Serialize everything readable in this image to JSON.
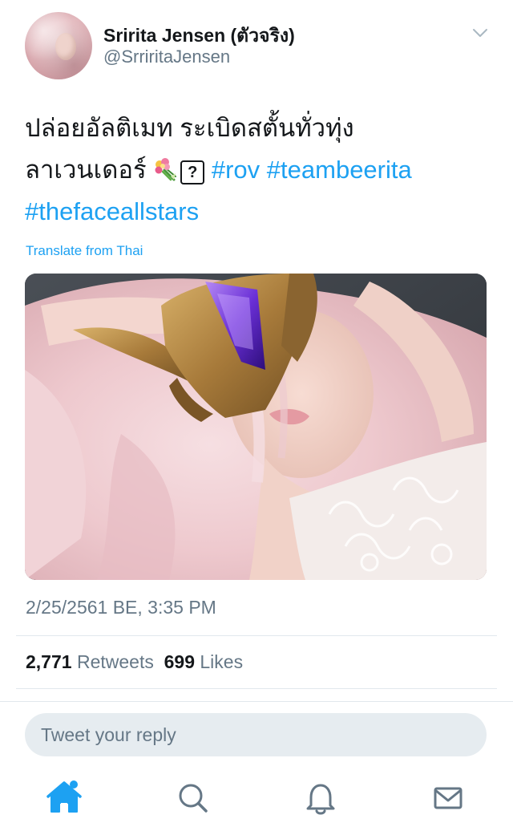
{
  "tweet": {
    "author": {
      "display_name": "Sririta Jensen (ตัวจริง)",
      "handle": "@SrriritaJensen"
    },
    "text_lines": {
      "line1": "ปล่อยอัลติเมท ระเบิดสตั้นทั่วทุ่ง",
      "line2_text": "ลาเวนเดอร์",
      "missing_glyph": "?",
      "hashtag_rov": "#rov",
      "hashtag_teambeerita": "#teambeerita",
      "hashtag_thefaceallstars": "#thefaceallstars"
    },
    "translate_label": "Translate from Thai",
    "timestamp": "2/25/2561 BE, 3:35 PM",
    "stats": {
      "retweets_count": "2,771",
      "retweets_label": "Retweets",
      "likes_count": "699",
      "likes_label": "Likes"
    }
  },
  "reply": {
    "placeholder": "Tweet your reply"
  },
  "tab_bar": {
    "items": [
      {
        "icon": "home-icon",
        "active": true,
        "notification_dot": true
      },
      {
        "icon": "search-icon",
        "active": false
      },
      {
        "icon": "bell-icon",
        "active": false
      },
      {
        "icon": "mail-icon",
        "active": false
      }
    ]
  },
  "colors": {
    "accent": "#1da1f2",
    "text_primary": "#14171a",
    "text_secondary": "#657786",
    "divider": "#e1e8ed",
    "input_bg": "#e6ecf0"
  }
}
